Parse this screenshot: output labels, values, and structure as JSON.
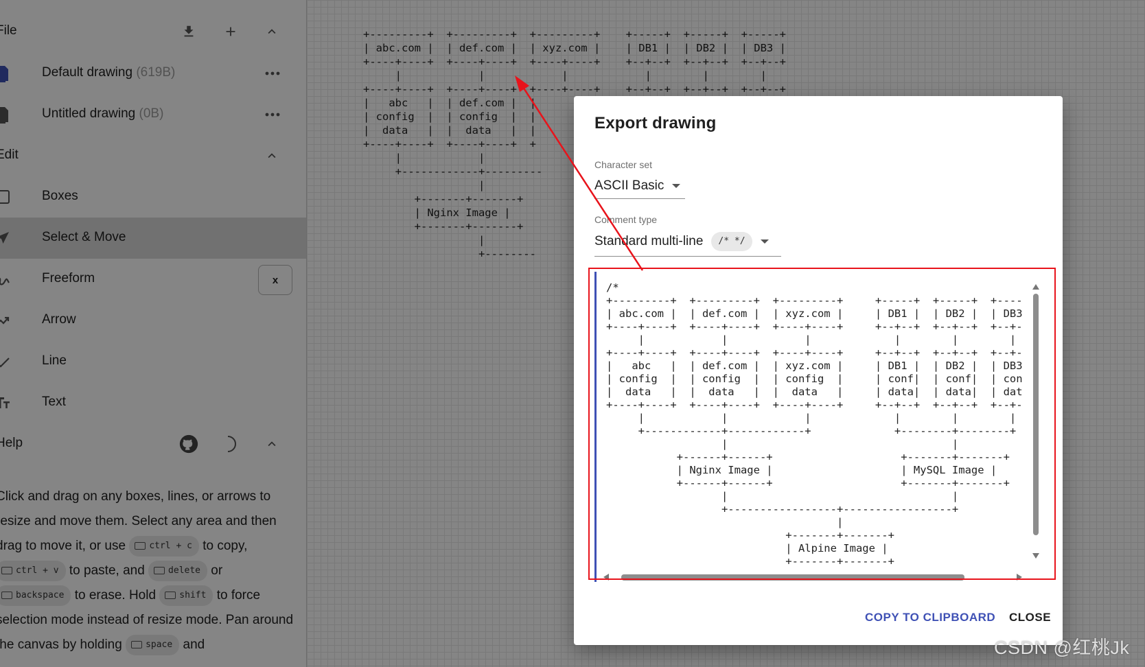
{
  "sidebar": {
    "file_section": {
      "title": "File"
    },
    "drawings": [
      {
        "name": "Default drawing",
        "size": "(619B)"
      },
      {
        "name": "Untitled drawing",
        "size": "(0B)"
      }
    ],
    "edit_section": {
      "title": "Edit"
    },
    "tools": [
      {
        "label": "Boxes",
        "icon": "square-icon"
      },
      {
        "label": "Select & Move",
        "icon": "cursor-arrow-icon"
      },
      {
        "label": "Freeform",
        "icon": "freeform-icon",
        "shortcut": "x"
      },
      {
        "label": "Arrow",
        "icon": "arrow-tool-icon"
      },
      {
        "label": "Line",
        "icon": "line-tool-icon"
      },
      {
        "label": "Text",
        "icon": "text-tool-icon"
      }
    ],
    "help_section": {
      "title": "Help"
    },
    "help": {
      "t1": "Click and drag on any boxes, lines, or arrows to resize and move them. Select any area and then drag to move it, or use ",
      "k1": "ctrl + c",
      "t2": " to copy, ",
      "k2": "ctrl + v",
      "t3": " to paste, and ",
      "k3": "delete",
      "t4": " or ",
      "k4": "backspace",
      "t5": " to erase. Hold ",
      "k5": "shift",
      "t6": " to force selection mode instead of resize mode. Pan around the canvas by holding ",
      "k6": "space",
      "t7": " and"
    }
  },
  "canvas": {
    "ascii": "+---------+  +---------+  +---------+    +-----+  +-----+  +-----+\n| abc.com |  | def.com |  | xyz.com |    | DB1 |  | DB2 |  | DB3 |\n+----+----+  +----+----+  +----+----+    +--+--+  +--+--+  +--+--+\n     |            |            |            |        |        |\n+----+----+  +----+----+  +----+----+    +--+--+  +--+--+  +--+--+\n|   abc   |  | def.com |  |\n| config  |  | config  |  |\n|  data   |  |  data   |  |\n+----+----+  +----+----+  +\n     |            |\n     +------------+---------\n                  |\n        +-------+-------+\n        | Nginx Image |\n        +-------+-------+\n                  |\n                  +--------"
  },
  "dialog": {
    "title": "Export drawing",
    "charset_label": "Character set",
    "charset_value": "ASCII Basic",
    "comment_label": "Comment type",
    "comment_value": "Standard multi-line",
    "comment_chip": "/* */",
    "code": "/*\n+---------+  +---------+  +---------+     +-----+  +-----+  +----\n| abc.com |  | def.com |  | xyz.com |     | DB1 |  | DB2 |  | DB3\n+----+----+  +----+----+  +----+----+     +--+--+  +--+--+  +--+-\n     |            |            |             |        |        |\n+----+----+  +----+----+  +----+----+     +--+--+  +--+--+  +--+-\n|   abc   |  | def.com |  | xyz.com |     | DB1 |  | DB2 |  | DB3\n| config  |  | config  |  | config  |     | conf|  | conf|  | con\n|  data   |  |  data   |  |  data   |     | data|  | data|  | dat\n+----+----+  +----+----+  +----+----+     +--+--+  +--+--+  +--+-\n     |            |            |             |        |        |\n     +------------+------------+             +--------+--------+\n                  |                                   |\n           +------+------+                    +-------+-------+\n           | Nginx Image |                    | MySQL Image |\n           +------+------+                    +-------+-------+\n                  |                                   |\n                  +-----------------+-----------------+\n                                    |\n                            +-------+-------+\n                            | Alpine Image |\n                            +-------+-------+\n\n */",
    "copy_button": "COPY TO CLIPBOARD",
    "close_button": "CLOSE"
  },
  "watermark": "CSDN @红桃Jk",
  "colors": {
    "accent": "#3f51b5",
    "annotation": "#e8131b",
    "selected_bg": "#d9d9d9"
  }
}
